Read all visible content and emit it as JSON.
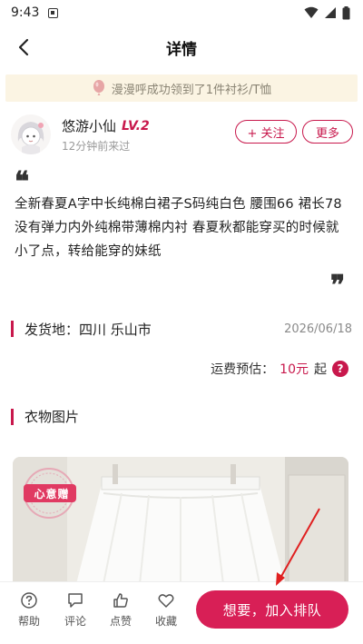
{
  "status_bar": {
    "time": "9:43"
  },
  "nav": {
    "title": "详情"
  },
  "banner": {
    "text": "漫漫呼成功领到了1件衬衫/T恤"
  },
  "user": {
    "name": "悠游小仙",
    "level": "LV.2",
    "last_seen": "12分钟前来过",
    "follow_label": "+ 关注",
    "more_label": "更多"
  },
  "description": {
    "open_quote": "❝",
    "text": "全新春夏A字中长纯棉白裙子S码纯白色 腰围66 裙长78 没有弹力内外纯棉带薄棉内衬 春夏秋都能穿买的时候就小了点，转给能穿的妹纸",
    "close_quote": "❞"
  },
  "shipping": {
    "label": "发货地：四川 乐山市",
    "date": "2026/06/18"
  },
  "fee": {
    "label": "运费预估：",
    "value": "10元",
    "suffix": "起",
    "help": "?"
  },
  "photos": {
    "title": "衣物图片",
    "stamp_text": "心意赠"
  },
  "bottom_bar": {
    "tabs": [
      {
        "label": "帮助",
        "icon": "help-icon"
      },
      {
        "label": "评论",
        "icon": "comment-icon"
      },
      {
        "label": "点赞",
        "icon": "thumbs-up-icon"
      },
      {
        "label": "收藏",
        "icon": "heart-icon"
      }
    ],
    "cta_label": "想要，加入排队"
  },
  "colors": {
    "accent": "#c8184c",
    "cta": "#d81f56",
    "banner_bg": "#fbf4e3"
  }
}
